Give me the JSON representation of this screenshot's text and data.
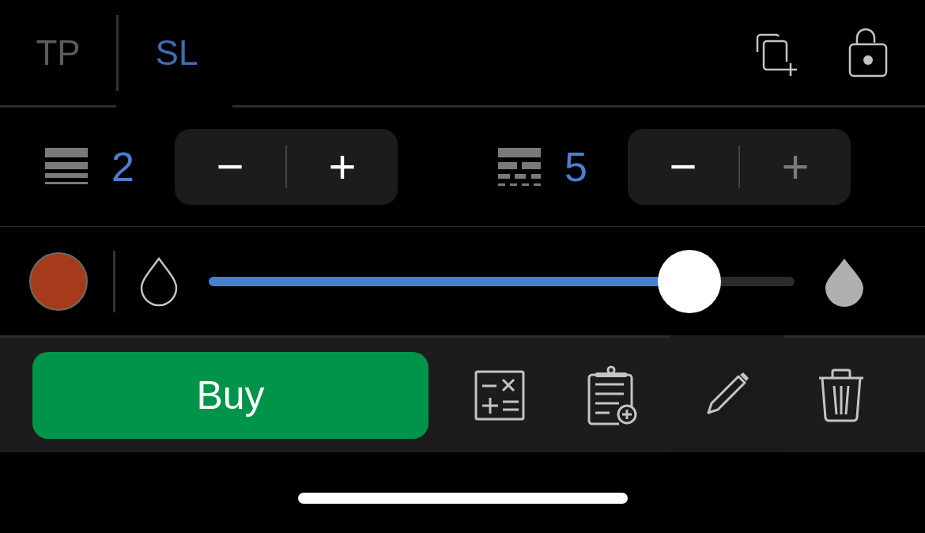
{
  "tabs": [
    {
      "label": "TP",
      "selected": false
    },
    {
      "label": "SL",
      "selected": true
    }
  ],
  "steppers": [
    {
      "kind": "solid",
      "value": "2",
      "minus": "−",
      "plus": "+",
      "plus_disabled": false
    },
    {
      "kind": "dashed",
      "value": "5",
      "minus": "−",
      "plus": "+",
      "plus_disabled": true
    }
  ],
  "color": {
    "color": "#a63b1b"
  },
  "opacity": {
    "level": 0.82
  },
  "buy_button": "Buy",
  "tools": [
    {
      "kind": "calculator",
      "selected": false
    },
    {
      "kind": "clipboard",
      "selected": false
    },
    {
      "kind": "pencil",
      "selected": true
    },
    {
      "kind": "trash",
      "selected": false
    }
  ]
}
